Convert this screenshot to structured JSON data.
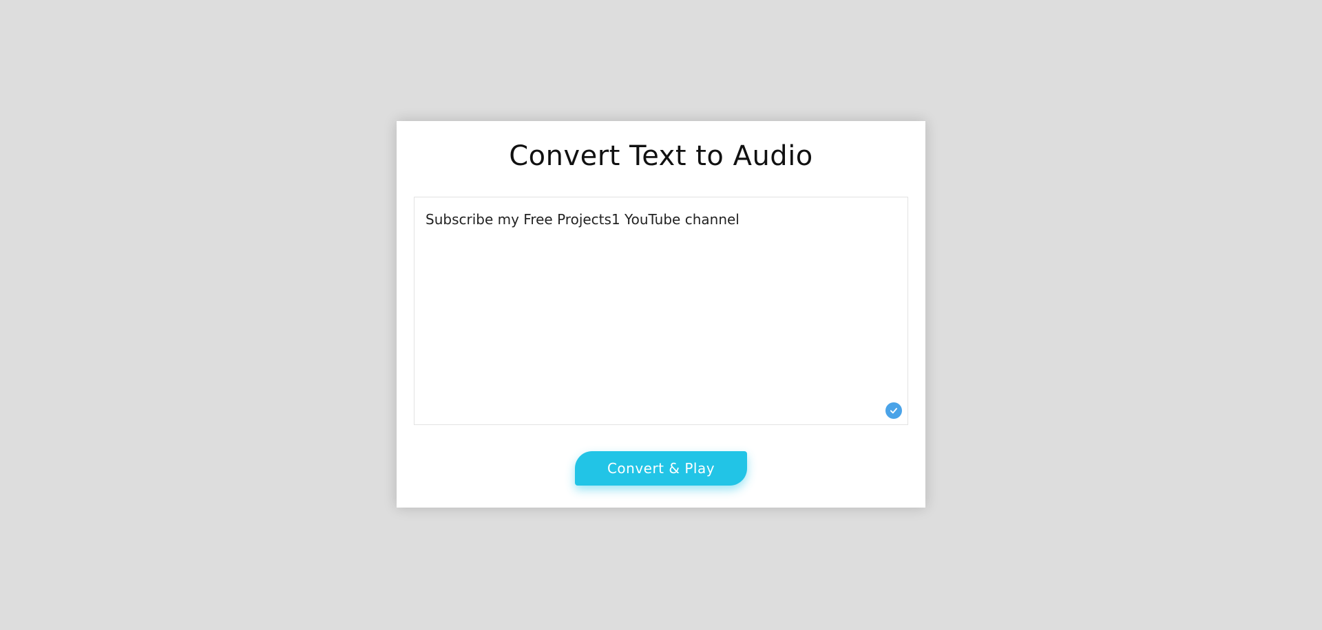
{
  "app": {
    "title": "Convert Text to Audio"
  },
  "editor": {
    "value": "Subscribe my Free Projects1 YouTube channel",
    "check_icon": "checkmark-circle-icon"
  },
  "actions": {
    "convert_label": "Convert & Play"
  },
  "colors": {
    "background": "#dddddd",
    "card": "#ffffff",
    "accent": "#22c4e6",
    "badge": "#4aa3e8"
  }
}
